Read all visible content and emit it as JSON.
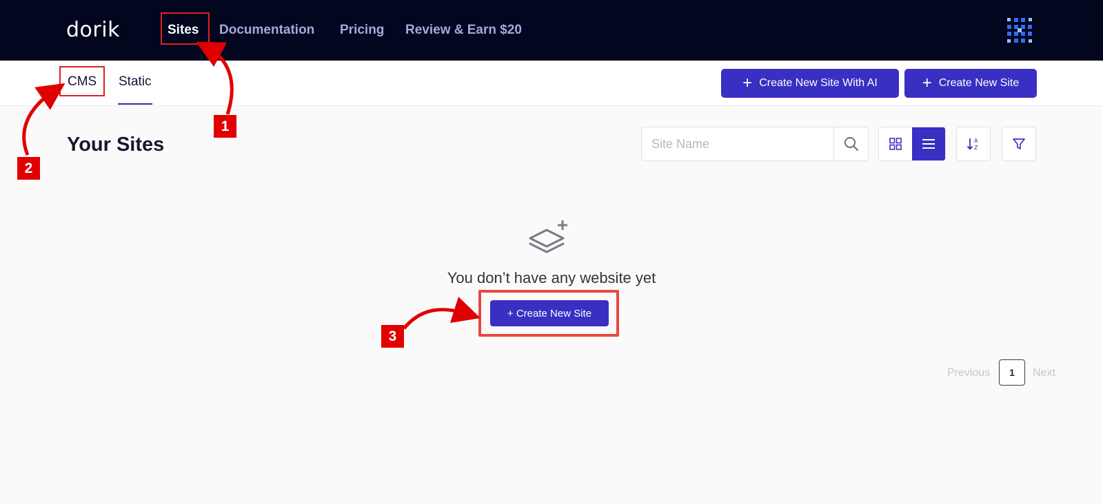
{
  "header": {
    "logo_text": "dorik",
    "nav": [
      {
        "label": "Sites",
        "active": true
      },
      {
        "label": "Documentation"
      },
      {
        "label": "Pricing"
      },
      {
        "label": "Review & Earn $20"
      }
    ]
  },
  "subnav": {
    "tabs": [
      {
        "label": "CMS"
      },
      {
        "label": "Static",
        "active": true
      }
    ],
    "create_ai_label": "Create New Site With AI",
    "create_label": "Create New Site"
  },
  "main": {
    "title": "Your Sites",
    "search_placeholder": "Site Name",
    "empty_message": "You don’t have any website yet",
    "empty_button_label": "+ Create New Site"
  },
  "pagination": {
    "previous": "Previous",
    "current_page": "1",
    "next": "Next"
  },
  "annotations": {
    "badges": [
      "1",
      "2",
      "3"
    ],
    "color": "#e00000"
  },
  "colors": {
    "nav_bg": "#03061f",
    "accent": "#3a2fc3",
    "nav_inactive": "#a8a7dc"
  }
}
